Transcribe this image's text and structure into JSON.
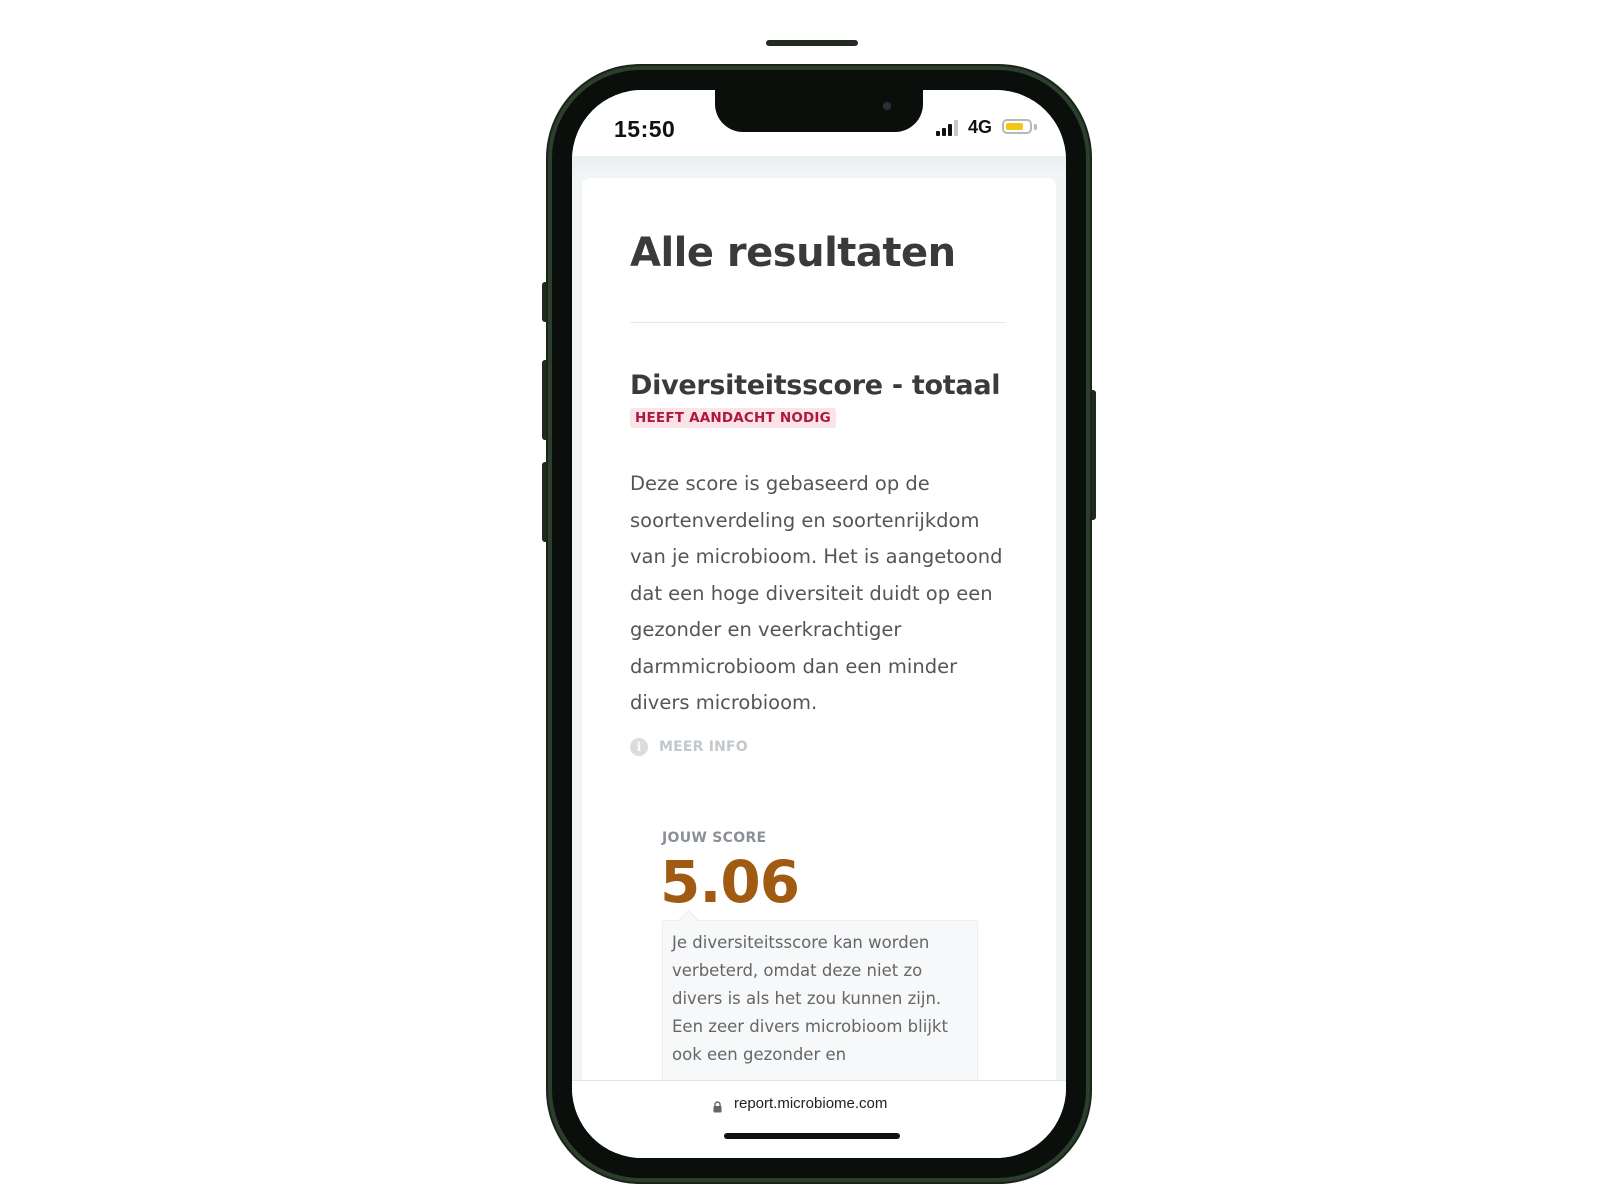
{
  "status_bar": {
    "time": "15:50",
    "network": "4G",
    "battery_level": 0.75,
    "battery_color": "#f5c518"
  },
  "page": {
    "title": "Alle resultaten"
  },
  "section": {
    "title": "Diversiteitsscore - totaal",
    "status_badge": "HEEFT AANDACHT NODIG",
    "badge_text_color": "#b0173d",
    "badge_bg_color": "#fbe3ea",
    "description": "Deze score is gebaseerd op de soortenverdeling en soortenrijkdom van je microbioom. Het is aangetoond dat een hoge diversiteit duidt op een gezonder en veerkrachtiger darmmicrobioom dan een minder divers microbioom.",
    "more_info_label": "MEER INFO"
  },
  "score": {
    "label": "JOUW SCORE",
    "value": "5.06",
    "value_color": "#a05a12",
    "explanation": "Je diversiteitsscore kan worden verbeterd, omdat deze niet zo divers is als het zou kunnen zijn. Een zeer divers microbioom blijkt ook een gezonder en"
  },
  "browser": {
    "url": "report.microbiome.com"
  },
  "icons": {
    "signal": "signal-bars-icon",
    "battery": "battery-icon",
    "info": "info-icon",
    "lock": "lock-icon"
  }
}
